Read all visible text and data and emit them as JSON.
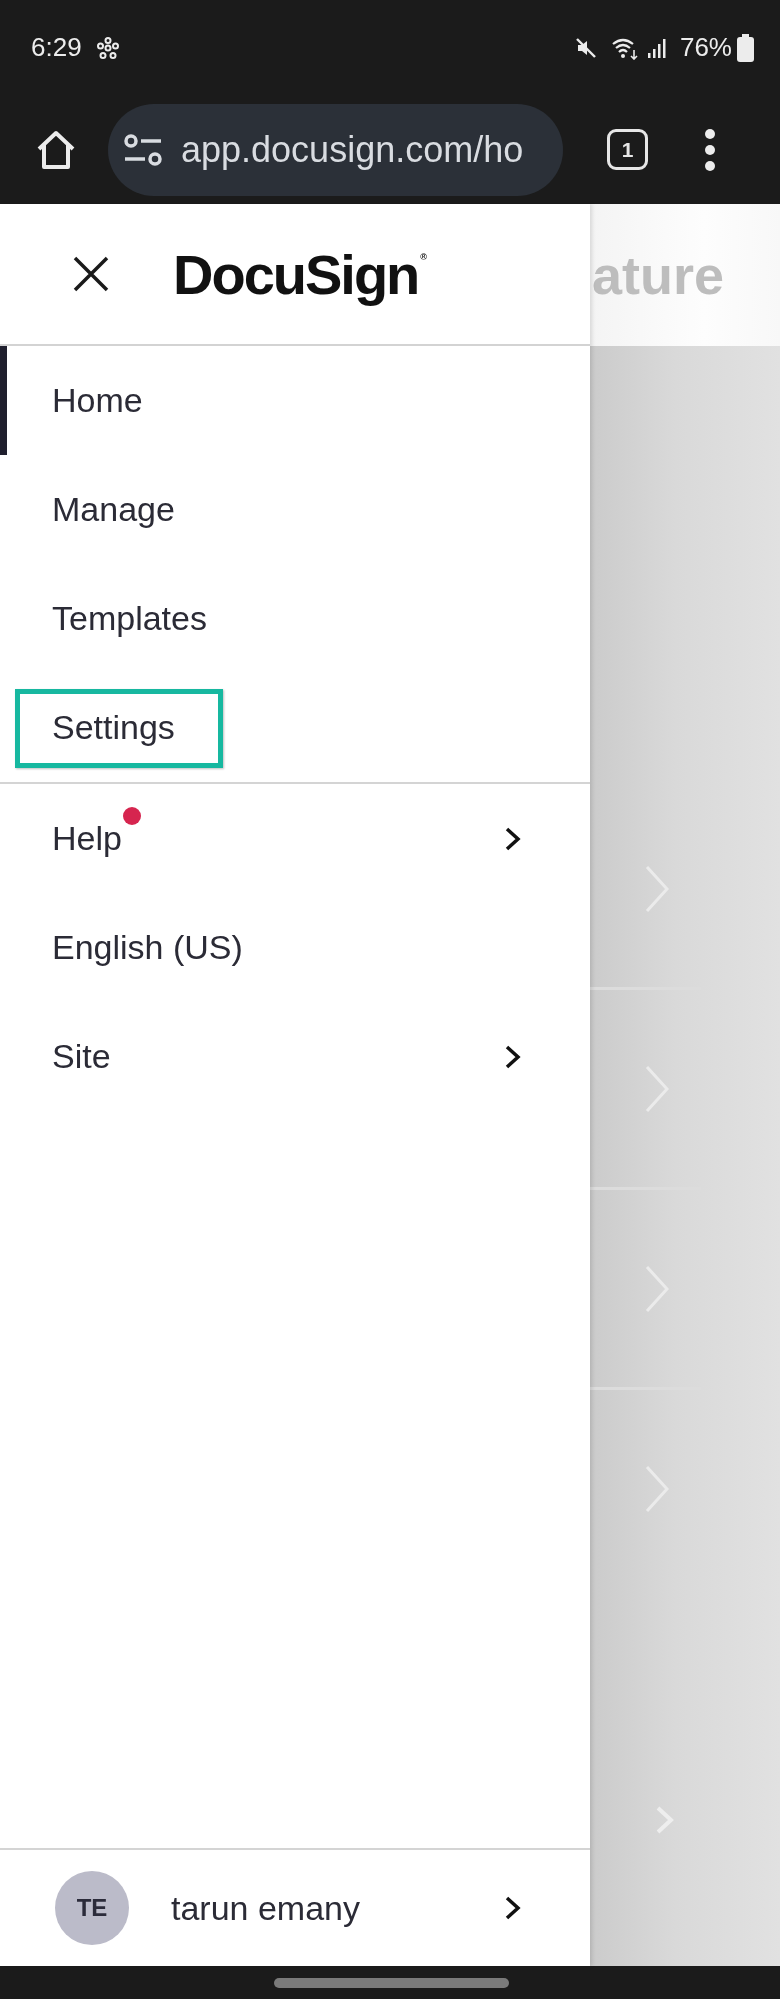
{
  "status_bar": {
    "time": "6:29",
    "battery": "76%"
  },
  "browser": {
    "url": "app.docusign.com/ho",
    "tab_count": "1"
  },
  "drawer": {
    "logo": "DocuSign$^{®}$",
    "primary_items": [
      {
        "label": "Home",
        "selected": true,
        "highlighted": false
      },
      {
        "label": "Manage",
        "selected": false,
        "highlighted": false
      },
      {
        "label": "Templates",
        "selected": false,
        "highlighted": false
      },
      {
        "label": "Settings",
        "selected": false,
        "highlighted": true
      }
    ],
    "secondary_items": [
      {
        "label": "Help",
        "submenu": true,
        "badge": true
      },
      {
        "label": "English (US)",
        "submenu": false,
        "badge": false
      },
      {
        "label": "Site",
        "submenu": true,
        "badge": false
      }
    ],
    "user": {
      "initials": "TE",
      "name": "tarun emany"
    }
  },
  "background": {
    "heading": "ature"
  }
}
